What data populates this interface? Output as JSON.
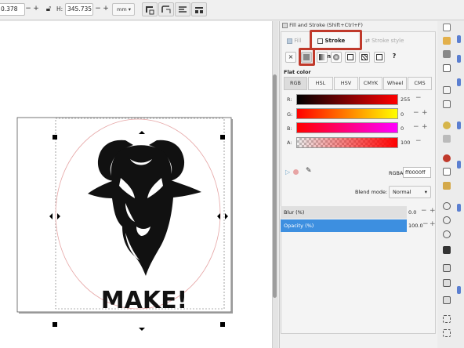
{
  "toolbar": {
    "x_value": "0.378",
    "h_label": "H:",
    "h_value": "345.735",
    "unit": "mm",
    "minus": "−",
    "plus": "+",
    "lock_icon": "lock-icon"
  },
  "dialog": {
    "title": "Fill and Stroke (Shift+Ctrl+F)",
    "tabs": {
      "fill": "Fill",
      "stroke_paint": "Stroke paint",
      "stroke_style": "Stroke style"
    },
    "paint_buttons": {
      "none": "×",
      "unset": "?"
    },
    "flat_color": "Flat color",
    "modes": [
      "RGB",
      "HSL",
      "HSV",
      "CMYK",
      "Wheel",
      "CMS"
    ],
    "channels": [
      {
        "label": "R:",
        "value": "255"
      },
      {
        "label": "G:",
        "value": "0"
      },
      {
        "label": "B:",
        "value": "0"
      },
      {
        "label": "A:",
        "value": "100"
      }
    ],
    "rgba_label": "RGBA:",
    "rgba_value": "ff0000ff",
    "blend_label": "Blend mode:",
    "blend_value": "Normal",
    "blur_label": "Blur (%)",
    "blur_value": "0.0",
    "opacity_label": "Opacity (%)",
    "opacity_value": "100.0"
  },
  "artwork": {
    "text": "MAKE!"
  },
  "colors": {
    "highlight": "#c0392b",
    "stroke_red": "#ff0000",
    "opacity_bar": "#3d8fe0"
  }
}
